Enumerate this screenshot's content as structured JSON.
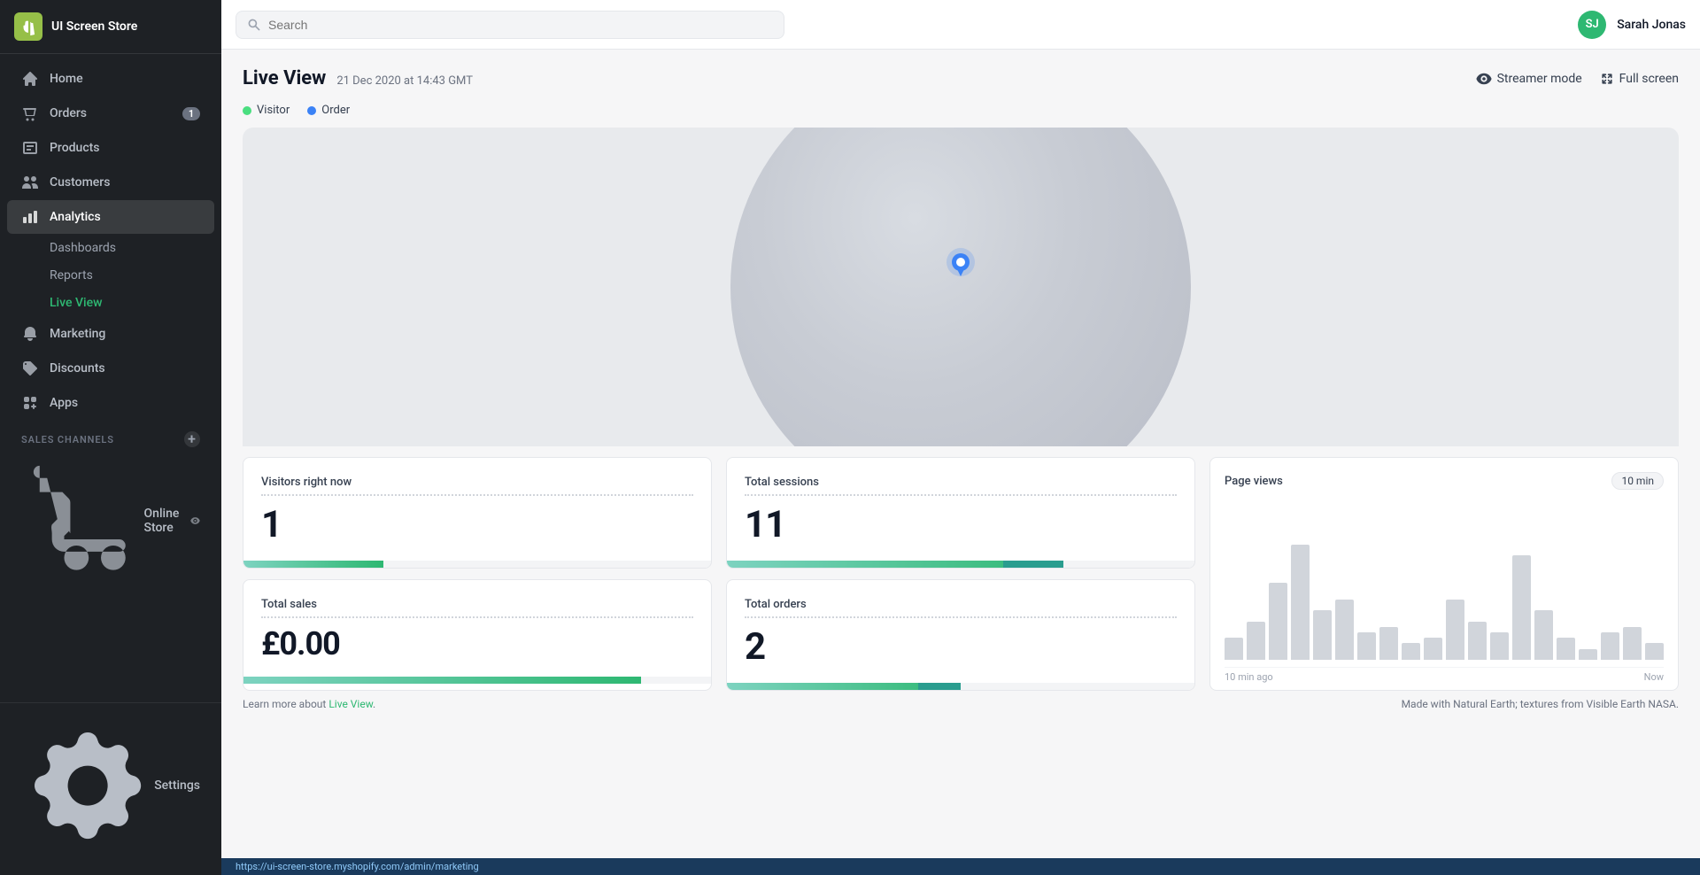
{
  "sidebar": {
    "store_name": "UI Screen Store",
    "nav_items": [
      {
        "id": "home",
        "label": "Home",
        "icon": "home"
      },
      {
        "id": "orders",
        "label": "Orders",
        "icon": "orders",
        "badge": "1"
      },
      {
        "id": "products",
        "label": "Products",
        "icon": "products"
      },
      {
        "id": "customers",
        "label": "Customers",
        "icon": "customers"
      },
      {
        "id": "analytics",
        "label": "Analytics",
        "icon": "analytics",
        "expanded": true
      },
      {
        "id": "marketing",
        "label": "Marketing",
        "icon": "marketing"
      },
      {
        "id": "discounts",
        "label": "Discounts",
        "icon": "discounts"
      },
      {
        "id": "apps",
        "label": "Apps",
        "icon": "apps"
      }
    ],
    "analytics_sub": [
      {
        "id": "dashboards",
        "label": "Dashboards"
      },
      {
        "id": "reports",
        "label": "Reports"
      },
      {
        "id": "live-view",
        "label": "Live View",
        "active": true
      }
    ],
    "sales_channels_label": "SALES CHANNELS",
    "online_store_label": "Online Store",
    "settings_label": "Settings"
  },
  "topbar": {
    "search_placeholder": "Search",
    "user_name": "Sarah Jonas",
    "user_initials": "SJ"
  },
  "page": {
    "title": "Live View",
    "subtitle": "21 Dec 2020 at 14:43 GMT",
    "legend": [
      {
        "label": "Visitor",
        "color": "#4ade80"
      },
      {
        "label": "Order",
        "color": "#3b82f6"
      }
    ],
    "streamer_mode_label": "Streamer mode",
    "full_screen_label": "Full screen"
  },
  "stats": {
    "visitors": {
      "label": "Visitors right now",
      "value": "1",
      "bar_width": "30"
    },
    "sessions": {
      "label": "Total sessions",
      "value": "11",
      "bar_width": "72",
      "bar_dark_width": "10"
    },
    "sales": {
      "label": "Total sales",
      "value": "£0.00",
      "bar_width": "85"
    },
    "orders": {
      "label": "Total orders",
      "value": "2",
      "bar_width": "50",
      "bar_dark_width": "10"
    }
  },
  "page_views": {
    "title": "Page views",
    "time_badge": "10 min",
    "time_start": "10 min ago",
    "time_end": "Now",
    "bars": [
      8,
      14,
      28,
      42,
      18,
      22,
      10,
      12,
      6,
      8,
      22,
      14,
      10,
      38,
      18,
      8,
      4,
      10,
      12,
      6
    ]
  },
  "footer": {
    "learn_text": "Learn more about",
    "link_text": "Live View",
    "attribution": "Made with Natural Earth; textures from Visible Earth NASA."
  },
  "status_bar": {
    "url": "https://ui-screen-store.myshopify.com/admin/marketing"
  }
}
